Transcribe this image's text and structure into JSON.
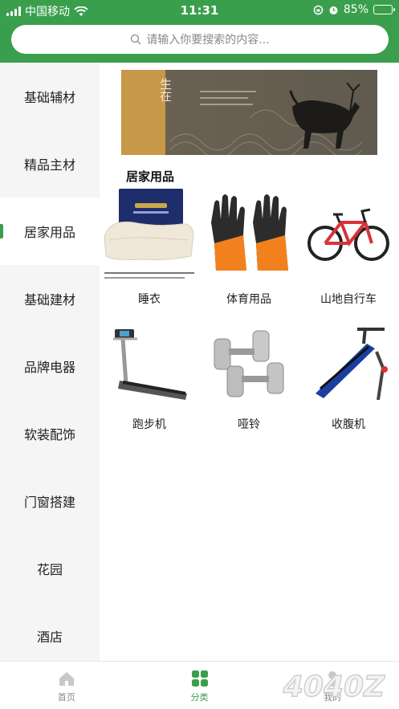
{
  "status_bar": {
    "carrier": "中国移动",
    "time": "11:31",
    "battery": "85%",
    "battery_level": 0.85
  },
  "search": {
    "placeholder": "请输入你要搜索的内容..."
  },
  "sidebar": {
    "items": [
      {
        "label": "基础辅材",
        "active": false
      },
      {
        "label": "精品主材",
        "active": false
      },
      {
        "label": "居家用品",
        "active": true
      },
      {
        "label": "基础建材",
        "active": false
      },
      {
        "label": "品牌电器",
        "active": false
      },
      {
        "label": "软装配饰",
        "active": false
      },
      {
        "label": "门窗搭建",
        "active": false
      },
      {
        "label": "花园",
        "active": false
      },
      {
        "label": "酒店",
        "active": false
      }
    ]
  },
  "banner": {
    "text_top": "生",
    "text_bottom": "在"
  },
  "section": {
    "title": "居家用品"
  },
  "products": [
    {
      "label": "睡衣",
      "icon": "pillow-image"
    },
    {
      "label": "体育用品",
      "icon": "gloves-image"
    },
    {
      "label": "山地自行车",
      "icon": "bicycle-image"
    },
    {
      "label": "跑步机",
      "icon": "treadmill-image"
    },
    {
      "label": "哑铃",
      "icon": "dumbbell-image"
    },
    {
      "label": "收腹机",
      "icon": "situp-bench-image"
    }
  ],
  "tabbar": {
    "tabs": [
      {
        "label": "首页",
        "icon": "home-icon",
        "active": false
      },
      {
        "label": "分类",
        "icon": "grid-icon",
        "active": true
      },
      {
        "label": "我的",
        "icon": "user-icon",
        "active": false
      }
    ]
  },
  "watermark": "4040Z",
  "colors": {
    "accent": "#3a9f4c",
    "sidebar_bg": "#f5f5f5",
    "text": "#222222"
  }
}
